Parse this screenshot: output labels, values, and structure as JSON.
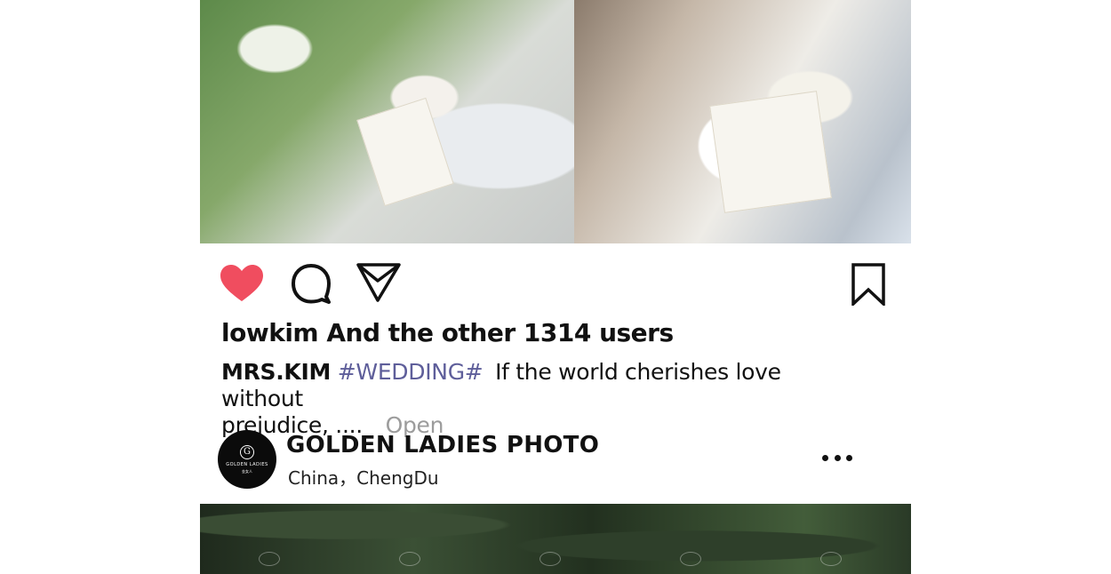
{
  "post": {
    "likes_text": "lowkim And the other 1314 users",
    "caption": {
      "author": "MRS.KIM",
      "hashtag": "#WEDDING#",
      "text_line1": "If the world cherishes love without",
      "text_line2": "prejudice, ....",
      "more_label": "Open"
    },
    "actions": {
      "like_icon": "heart-filled-icon",
      "comment_icon": "speech-bubble-icon",
      "share_icon": "paper-plane-icon",
      "save_icon": "bookmark-icon"
    },
    "colors": {
      "like": "#f04d5f",
      "hashtag": "#5e5e9a",
      "more_text": "#9c9c9c"
    }
  },
  "account": {
    "name": "GOLDEN LADIES PHOTO",
    "location": "China，ChengDu",
    "avatar": {
      "monogram": "G",
      "brand": "GOLDEN LADIES",
      "brand_cn": "金女人"
    },
    "more_icon": "ellipsis-icon"
  }
}
